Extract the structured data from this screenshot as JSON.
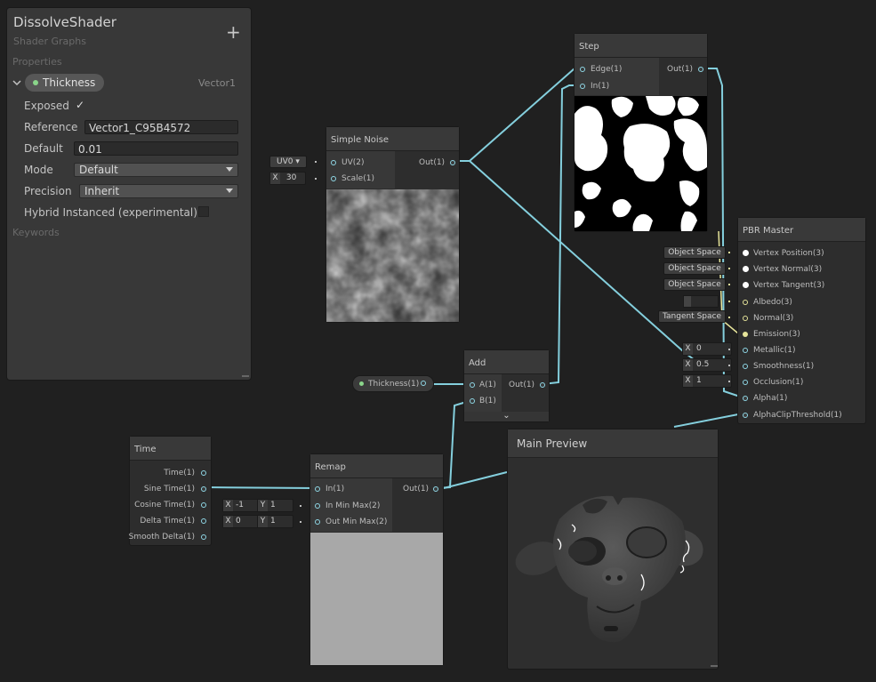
{
  "blackboard": {
    "title": "DissolveShader",
    "subtitle": "Shader Graphs",
    "add_label": "+",
    "properties_label": "Properties",
    "keywords_label": "Keywords",
    "property": {
      "name": "Thickness",
      "type": "Vector1",
      "exposed_label": "Exposed",
      "exposed_check": "✓",
      "reference_label": "Reference",
      "reference_value": "Vector1_C95B4572",
      "default_label": "Default",
      "default_value": "0.01",
      "mode_label": "Mode",
      "mode_value": "Default",
      "precision_label": "Precision",
      "precision_value": "Inherit",
      "hybrid_label": "Hybrid Instanced (experimental)"
    }
  },
  "simple_noise": {
    "title": "Simple Noise",
    "inputs": [
      "UV(2)",
      "Scale(1)"
    ],
    "output": "Out(1)",
    "uv_value": "UV0",
    "uv_arrow": "▾",
    "scale_x": "X",
    "scale_value": "30"
  },
  "step": {
    "title": "Step",
    "inputs": [
      "Edge(1)",
      "In(1)"
    ],
    "output": "Out(1)"
  },
  "add": {
    "title": "Add",
    "inputs": [
      "A(1)",
      "B(1)"
    ],
    "output": "Out(1)",
    "expand_icon": "⌄"
  },
  "thickness_node": {
    "label": "Thickness(1)"
  },
  "time": {
    "title": "Time",
    "outputs": [
      "Time(1)",
      "Sine Time(1)",
      "Cosine Time(1)",
      "Delta Time(1)",
      "Smooth Delta(1)"
    ]
  },
  "remap": {
    "title": "Remap",
    "inputs": [
      "In(1)",
      "In Min Max(2)",
      "Out Min Max(2)"
    ],
    "output": "Out(1)",
    "in_min_max": {
      "x_label": "X",
      "x": "-1",
      "y_label": "Y",
      "y": "1"
    },
    "out_min_max": {
      "x_label": "X",
      "x": "0",
      "y_label": "Y",
      "y": "1"
    }
  },
  "pbr_master": {
    "title": "PBR Master",
    "inputs": [
      "Vertex Position(3)",
      "Vertex Normal(3)",
      "Vertex Tangent(3)",
      "Albedo(3)",
      "Normal(3)",
      "Emission(3)",
      "Metallic(1)",
      "Smoothness(1)",
      "Occlusion(1)",
      "Alpha(1)",
      "AlphaClipThreshold(1)"
    ],
    "space_object": "Object Space",
    "space_tangent": "Tangent Space",
    "metallic": {
      "x_label": "X",
      "value": "0"
    },
    "smoothness": {
      "x_label": "X",
      "value": "0.5"
    },
    "occlusion": {
      "x_label": "X",
      "value": "1"
    }
  },
  "main_preview": {
    "title": "Main Preview"
  },
  "colors": {
    "background": "#202020",
    "wire_float": "#84cfdd",
    "wire_vector": "#e6e49a"
  }
}
